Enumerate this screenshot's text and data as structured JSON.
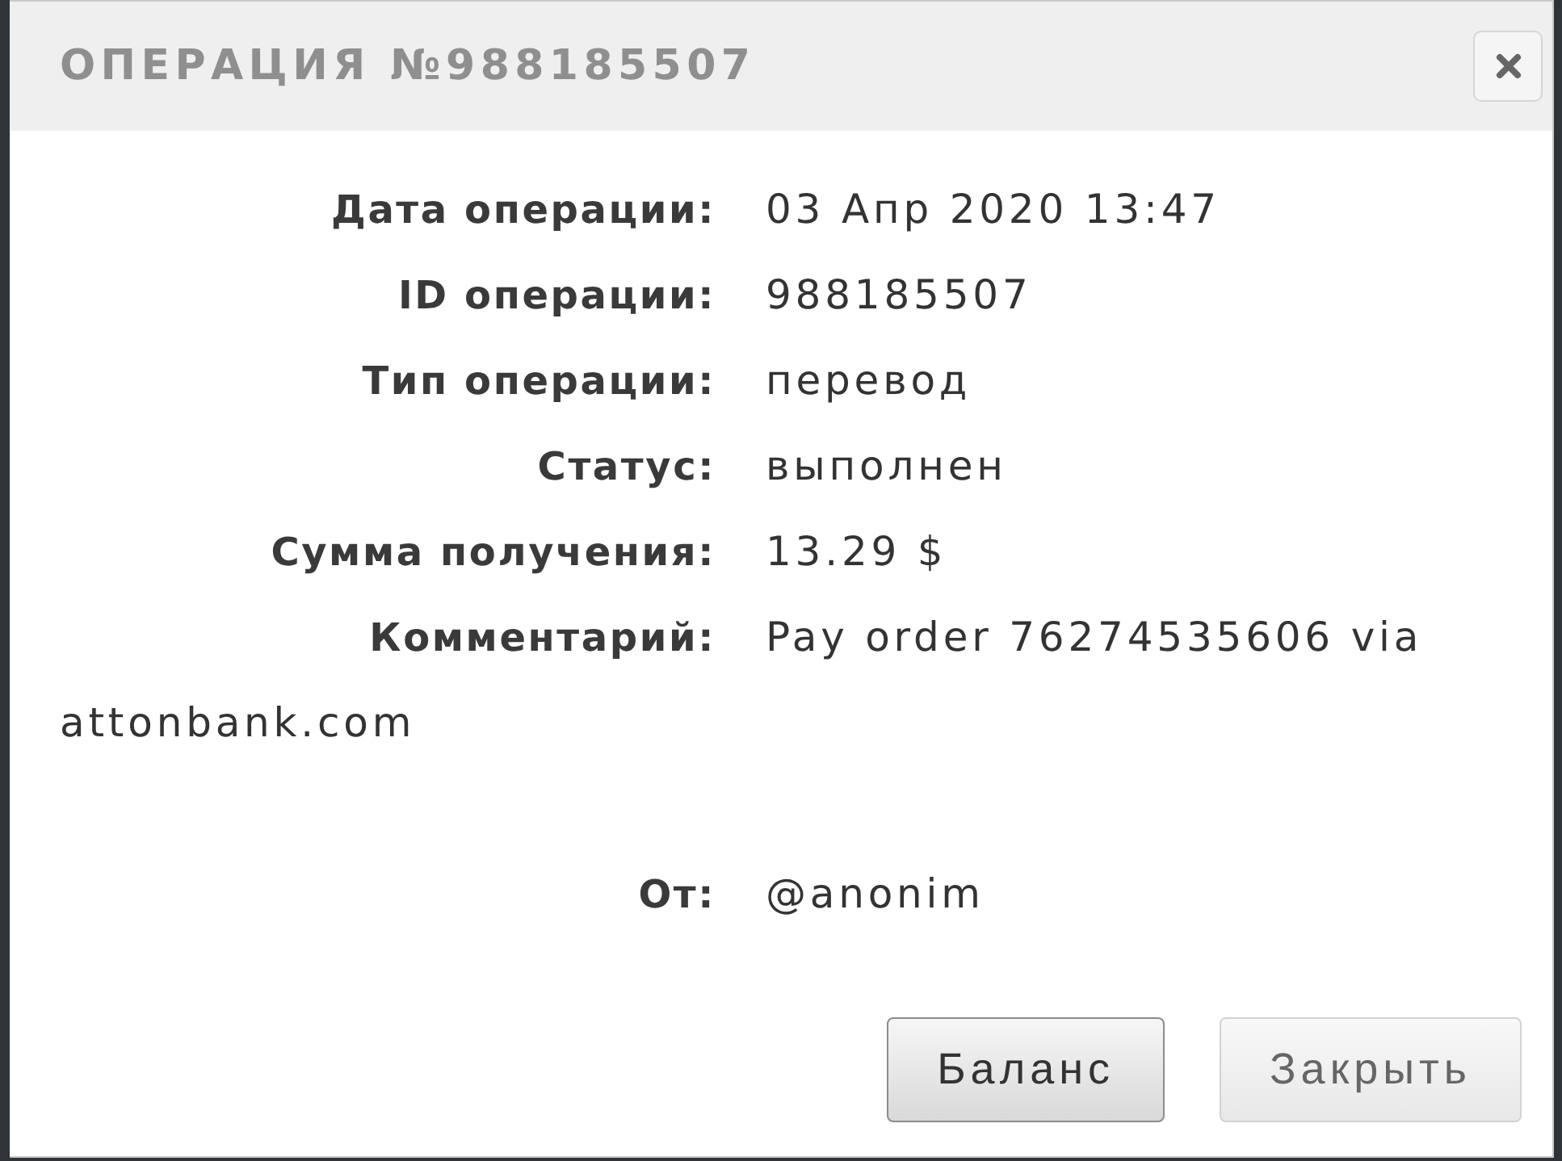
{
  "dialog": {
    "title": "ОПЕРАЦИЯ №988185507"
  },
  "fields": [
    {
      "label": "Дата операции:",
      "value": "03 Апр 2020 13:47"
    },
    {
      "label": "ID операции:",
      "value": "988185507"
    },
    {
      "label": "Тип операции:",
      "value": "перевод"
    },
    {
      "label": "Статус:",
      "value": "выполнен"
    },
    {
      "label": "Сумма получения:",
      "value": "13.29 $"
    },
    {
      "label": "Комментарий:",
      "value": "Pay order 76274535606 via",
      "continuation": "attonbank.com"
    }
  ],
  "sender": {
    "label": "От:",
    "value": "@anonim"
  },
  "buttons": [
    {
      "label": "Баланс",
      "kind": "primary"
    },
    {
      "label": "Закрыть",
      "kind": "secondary"
    }
  ]
}
